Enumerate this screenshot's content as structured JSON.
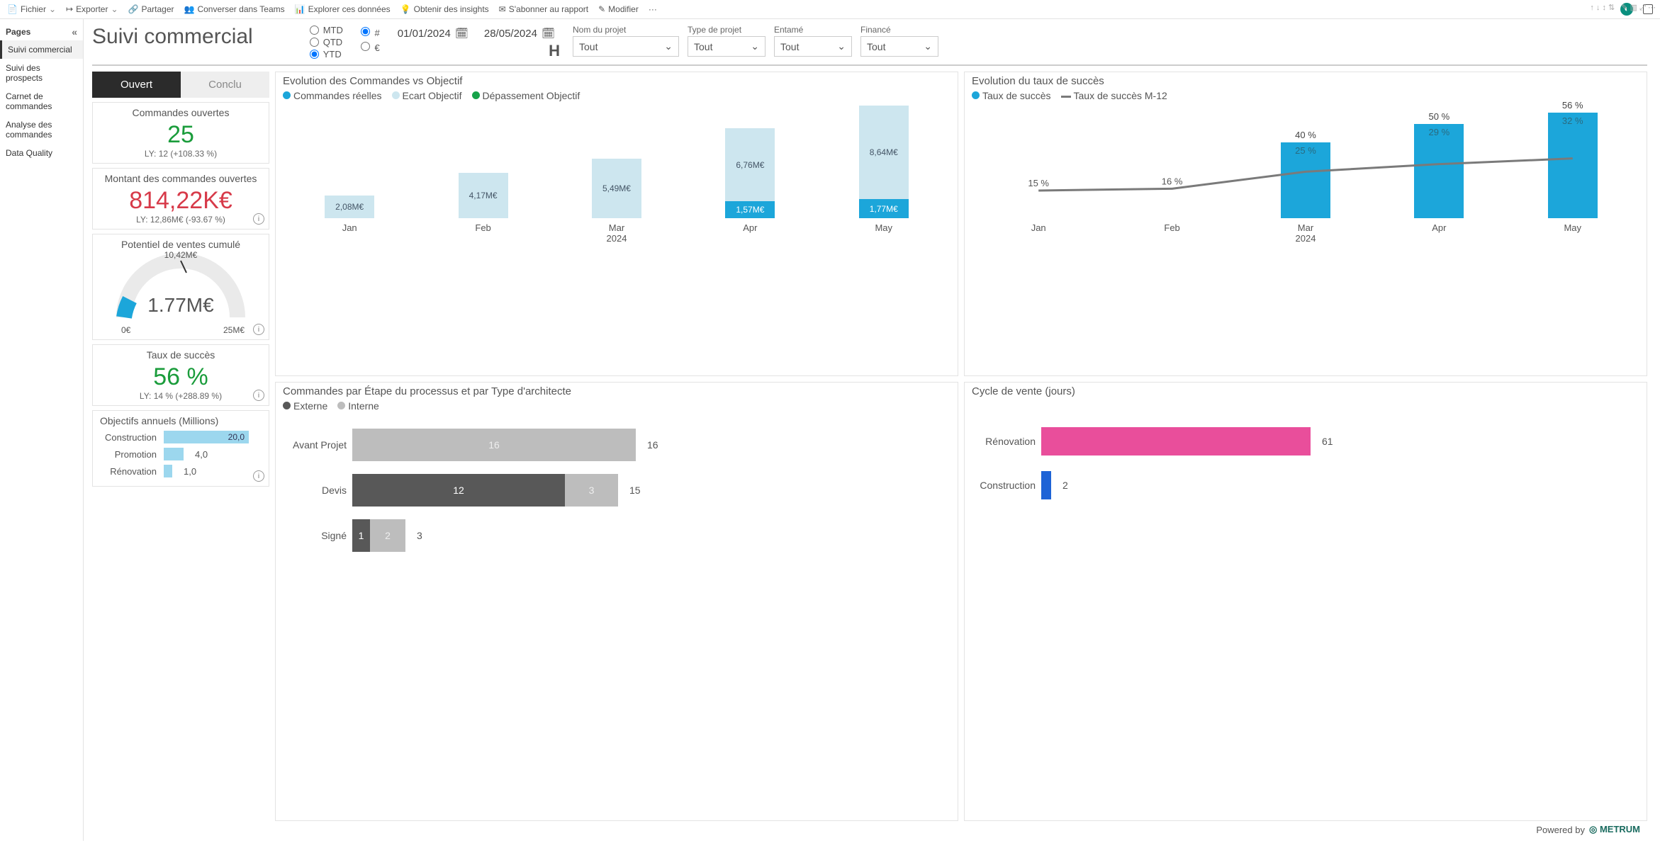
{
  "actions": {
    "fichier": "Fichier",
    "exporter": "Exporter",
    "partager": "Partager",
    "teams": "Converser dans Teams",
    "explorer": "Explorer ces données",
    "insights": "Obtenir des insights",
    "abonner": "S'abonner au rapport",
    "modifier": "Modifier",
    "more": "···"
  },
  "sidebar": {
    "header": "Pages",
    "items": [
      {
        "label": "Suivi commercial",
        "active": true
      },
      {
        "label": "Suivi des prospects"
      },
      {
        "label": "Carnet de commandes"
      },
      {
        "label": "Analyse des commandes"
      },
      {
        "label": "Data Quality"
      }
    ]
  },
  "header": {
    "title": "Suivi commercial",
    "period": {
      "mtd": "MTD",
      "qtd": "QTD",
      "ytd": "YTD",
      "selected": "YTD"
    },
    "unit": {
      "hash": "#",
      "eur": "€",
      "selected": "#"
    },
    "date_from": "01/01/2024",
    "date_to": "28/05/2024",
    "filters": [
      {
        "label": "Nom du projet",
        "value": "Tout"
      },
      {
        "label": "Type de projet",
        "value": "Tout"
      },
      {
        "label": "Entamé",
        "value": "Tout"
      },
      {
        "label": "Financé",
        "value": "Tout"
      }
    ]
  },
  "tabs": {
    "open": "Ouvert",
    "closed": "Conclu"
  },
  "kpis": {
    "open_orders": {
      "title": "Commandes ouvertes",
      "value": "25",
      "sub": "LY: 12 (+108.33 %)"
    },
    "open_amount": {
      "title": "Montant des commandes ouvertes",
      "value": "814,22K€",
      "sub": "LY: 12,86M€ (-93.67 %)"
    },
    "potential": {
      "title": "Potentiel de ventes cumulé",
      "value": "1.77M€",
      "target": "10,42M€",
      "min": "0€",
      "max": "25M€"
    },
    "success": {
      "title": "Taux de succès",
      "value": "56 %",
      "sub": "LY: 14 % (+288.89 %)"
    }
  },
  "objectives": {
    "title": "Objectifs annuels (Millions)",
    "rows": [
      {
        "label": "Construction",
        "value": "20,0",
        "w": 120
      },
      {
        "label": "Promotion",
        "value": "4,0",
        "w": 28
      },
      {
        "label": "Rénovation",
        "value": "1,0",
        "w": 12
      }
    ]
  },
  "chart_data": [
    {
      "id": "orders_vs_target",
      "type": "bar",
      "title": "Evolution des Commandes vs Objectif",
      "legend": [
        "Commandes réelles",
        "Ecart Objectif",
        "Dépassement Objectif"
      ],
      "categories": [
        "Jan",
        "Feb",
        "Mar",
        "Apr",
        "May"
      ],
      "year": "2024",
      "series": [
        {
          "name": "Commandes réelles",
          "values": [
            0,
            0,
            0,
            1.57,
            1.77
          ],
          "color": "#1ca6da"
        },
        {
          "name": "Ecart Objectif",
          "values": [
            2.08,
            4.17,
            5.49,
            6.76,
            8.64
          ],
          "color": "#cde6ef"
        },
        {
          "name": "Dépassement Objectif",
          "values": [
            0,
            0,
            0,
            0,
            0
          ],
          "color": "#16a34a"
        }
      ],
      "labels_top": [
        "2,08M€",
        "4,17M€",
        "5,49M€",
        "6,76M€",
        "8,64M€"
      ],
      "labels_bottom": [
        "",
        "",
        "",
        "1,57M€",
        "1,77M€"
      ],
      "ymax": 10.5
    },
    {
      "id": "success_rate",
      "type": "bar",
      "title": "Evolution du taux de succès",
      "legend": [
        "Taux de succès",
        "Taux de succès M-12"
      ],
      "categories": [
        "Jan",
        "Feb",
        "Mar",
        "Apr",
        "May"
      ],
      "year": "2024",
      "series": [
        {
          "name": "Taux de succès",
          "values": [
            0,
            0,
            40,
            50,
            56
          ],
          "color": "#1ca6da"
        },
        {
          "name": "Taux de succès M-12",
          "values": [
            15,
            16,
            25,
            29,
            32
          ],
          "color": "#7a7a7a",
          "type": "line"
        }
      ],
      "line_labels": [
        "15 %",
        "16 %",
        "25 %",
        "29 %",
        "32 %"
      ],
      "bar_labels": [
        "",
        "",
        "40 %",
        "50 %",
        "56 %"
      ],
      "ymax": 60
    },
    {
      "id": "orders_by_stage",
      "type": "bar",
      "orientation": "horizontal",
      "title": "Commandes par Étape du processus et par Type d'architecte",
      "legend": [
        "Externe",
        "Interne"
      ],
      "categories": [
        "Avant Projet",
        "Devis",
        "Signé"
      ],
      "series": [
        {
          "name": "Externe",
          "values": [
            0,
            12,
            1
          ],
          "color": "#585858"
        },
        {
          "name": "Interne",
          "values": [
            16,
            3,
            2
          ],
          "color": "#bdbdbd"
        }
      ],
      "totals": [
        16,
        15,
        3
      ],
      "xmax": 16
    },
    {
      "id": "sales_cycle",
      "type": "bar",
      "orientation": "horizontal",
      "title": "Cycle de vente (jours)",
      "categories": [
        "Rénovation",
        "Construction"
      ],
      "values": [
        61,
        2
      ],
      "colors": [
        "#e94e9b",
        "#1e63d6"
      ],
      "xmax": 61
    }
  ],
  "footer": {
    "powered": "Powered by",
    "brand": "METRUM"
  }
}
